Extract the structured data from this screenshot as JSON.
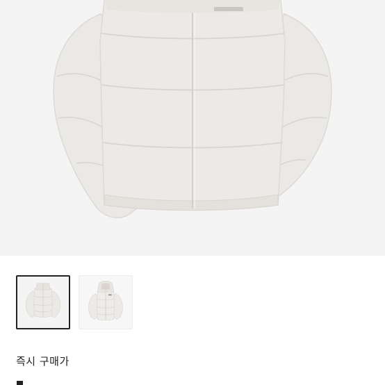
{
  "product": {
    "name": "",
    "main_image_icon": "puffer-jacket-front",
    "background_color": "#f4f4f4",
    "jacket_color": "#ebe9e6"
  },
  "gallery": {
    "selected_index": 0,
    "thumbnails": [
      {
        "icon": "puffer-jacket-front-thumbnail",
        "selected": true
      },
      {
        "icon": "hooded-puffer-jacket-thumbnail",
        "selected": false
      }
    ]
  },
  "purchase": {
    "label": "즉시 구매가"
  }
}
